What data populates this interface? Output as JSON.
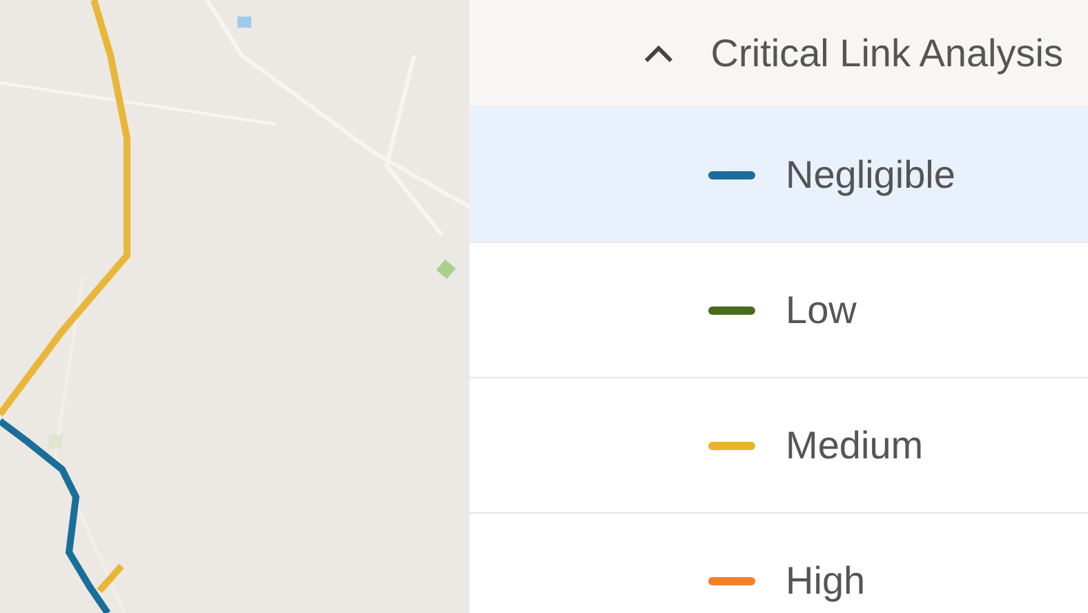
{
  "legend": {
    "title": "Critical Link Analysis",
    "expanded": true,
    "items": [
      {
        "label": "Negligible",
        "color": "#1a6e9a",
        "selected": true
      },
      {
        "label": "Low",
        "color": "#4a6b1e",
        "selected": false
      },
      {
        "label": "Medium",
        "color": "#ecb42a",
        "selected": false
      },
      {
        "label": "High",
        "color": "#f0802a",
        "selected": false
      }
    ]
  }
}
